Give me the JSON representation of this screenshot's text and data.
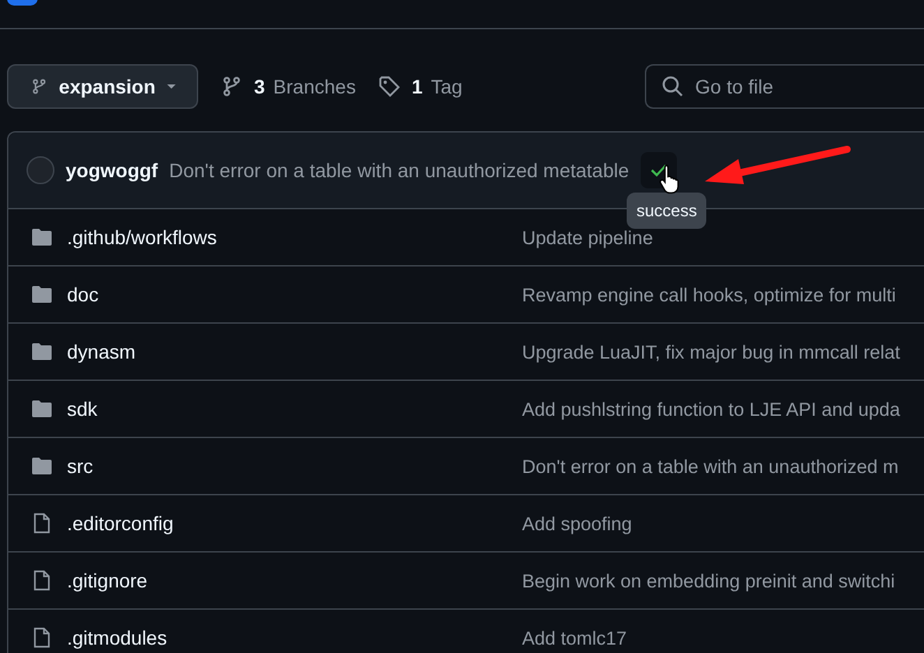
{
  "toolbar": {
    "branch": "expansion",
    "branch_count": "3",
    "branch_label": "Branches",
    "tag_count": "1",
    "tag_label": "Tag",
    "search": {
      "placeholder": "Go to file"
    }
  },
  "commit": {
    "author": "yogwoggf",
    "message": "Don't error on a table with an unauthorized metatable",
    "checks_passed": true,
    "tooltip": "success"
  },
  "files": [
    {
      "kind": "folder",
      "name": ".github/workflows",
      "message": "Update pipeline"
    },
    {
      "kind": "folder",
      "name": "doc",
      "message": "Revamp engine call hooks, optimize for multi"
    },
    {
      "kind": "folder",
      "name": "dynasm",
      "message": "Upgrade LuaJIT, fix major bug in mmcall relat"
    },
    {
      "kind": "folder",
      "name": "sdk",
      "message": "Add pushlstring function to LJE API and upda"
    },
    {
      "kind": "folder",
      "name": "src",
      "message": "Don't error on a table with an unauthorized m"
    },
    {
      "kind": "file",
      "name": ".editorconfig",
      "message": "Add spoofing"
    },
    {
      "kind": "file",
      "name": ".gitignore",
      "message": "Begin work on embedding preinit and switchi"
    },
    {
      "kind": "file",
      "name": ".gitmodules",
      "message": "Add tomlc17"
    }
  ]
}
